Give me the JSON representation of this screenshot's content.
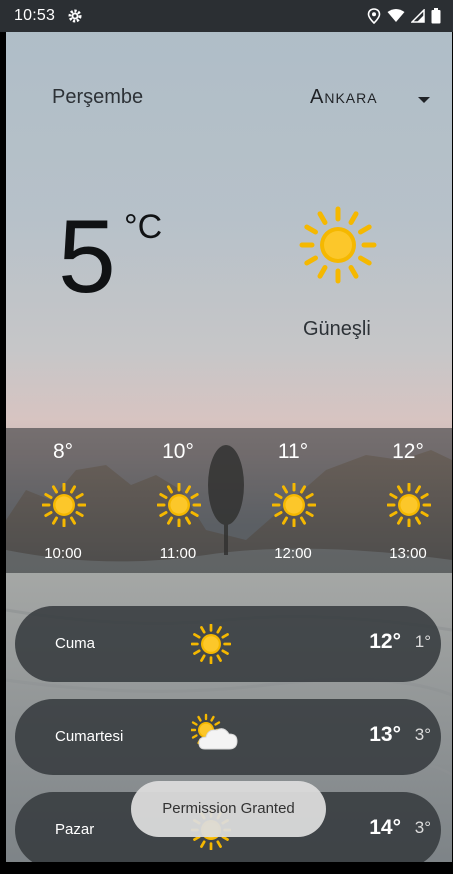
{
  "status_bar": {
    "time": "10:53",
    "icons": [
      "gear-icon",
      "location-icon",
      "wifi-icon",
      "signal-icon",
      "battery-icon"
    ]
  },
  "header": {
    "day": "Perşembe",
    "city": "Ankara",
    "dropdown_icon": "chevron-down-icon"
  },
  "current": {
    "temperature": "5",
    "unit": "°C",
    "icon": "sun-icon",
    "condition": "Güneşli"
  },
  "hourly": [
    {
      "temp": "8°",
      "time": "10:00",
      "icon": "sun-icon"
    },
    {
      "temp": "10°",
      "time": "11:00",
      "icon": "sun-icon"
    },
    {
      "temp": "11°",
      "time": "12:00",
      "icon": "sun-icon"
    },
    {
      "temp": "12°",
      "time": "13:00",
      "icon": "sun-icon"
    }
  ],
  "daily": [
    {
      "name": "Cuma",
      "high": "12°",
      "low": "1°",
      "icon": "sun-icon"
    },
    {
      "name": "Cumartesi",
      "high": "13°",
      "low": "3°",
      "icon": "partly-cloudy-icon"
    },
    {
      "name": "Pazar",
      "high": "14°",
      "low": "3°",
      "icon": "sun-icon"
    }
  ],
  "toast": "Permission Granted",
  "colors": {
    "sun": "#f5b800",
    "panel": "#34383c"
  }
}
